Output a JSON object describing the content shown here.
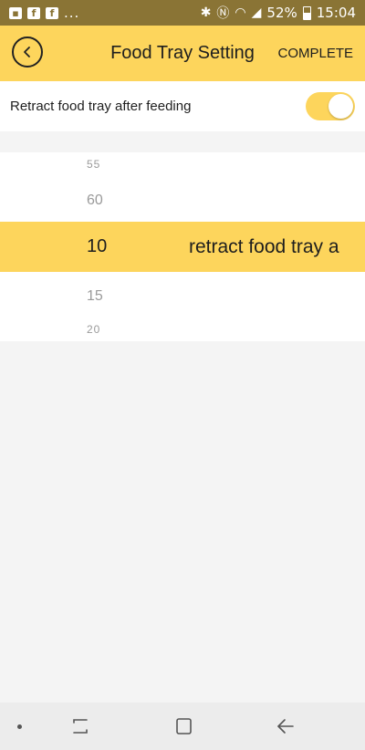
{
  "status_bar": {
    "left_icons": [
      "gallery-icon",
      "facebook-icon",
      "facebook-icon"
    ],
    "more": "...",
    "battery": "52%",
    "time": "15:04"
  },
  "header": {
    "title": "Food Tray Setting",
    "complete_label": "COMPLETE"
  },
  "settings": {
    "retract_label": "Retract food tray after feeding",
    "retract_enabled": true
  },
  "picker": {
    "items": [
      "55",
      "60",
      "10",
      "15",
      "20"
    ],
    "selected_value": "10",
    "selected_caption": "retract food tray a"
  },
  "colors": {
    "accent": "#fdd55c",
    "status_bar": "#8a7435",
    "background": "#f4f4f4"
  }
}
